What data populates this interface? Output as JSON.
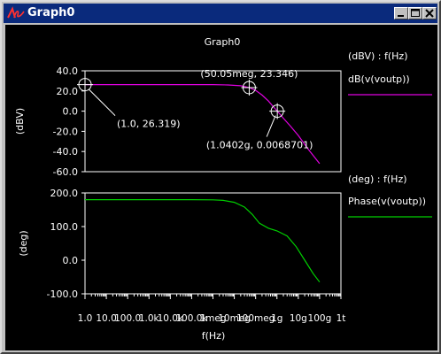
{
  "window": {
    "title": "Graph0"
  },
  "colors": {
    "titlebar": "#0a2a7c",
    "background": "#000000",
    "magnitude": "#e000e0",
    "phase": "#00d000",
    "frame": "#ffffff"
  },
  "icons": {
    "app": "app-logo-icon",
    "minimize": "minimize-icon",
    "maximize": "maximize-icon",
    "close": "close-icon"
  },
  "chart_data": [
    {
      "type": "line",
      "title": "Graph0",
      "xlabel": "f(Hz)",
      "ylabel": "(dBV)",
      "xscale": "log",
      "xlim": [
        1,
        1000000000000
      ],
      "ylim": [
        -60,
        40
      ],
      "yticks": [
        "40.0",
        "20.0",
        "0.0",
        "-20.0",
        "-40.0",
        "-60.0"
      ],
      "legend": {
        "placement": "right",
        "header": "(dBV) : f(Hz)",
        "label": "dB(v(voutp))"
      },
      "series": [
        {
          "name": "dB(v(voutp))",
          "x": [
            1,
            10,
            100,
            1000,
            10000,
            100000,
            1000000,
            5000000,
            20000000,
            50050000,
            100000000,
            200000000,
            400000000,
            700000000,
            1040200000,
            2000000000,
            4000000000,
            10000000000,
            30000000000,
            100000000000
          ],
          "y": [
            26.319,
            26.319,
            26.319,
            26.319,
            26.319,
            26.319,
            26.3,
            26.0,
            25.2,
            23.346,
            20.5,
            16,
            10,
            4,
            0.0068701,
            -7,
            -14,
            -24,
            -38,
            -52
          ]
        }
      ],
      "annotations": [
        {
          "label": "(1.0, 26.319)",
          "x": 1,
          "y": 26.319
        },
        {
          "label": "(50.05meg, 23.346)",
          "x": 50050000,
          "y": 23.346
        },
        {
          "label": "(1.0402g, 0.0068701)",
          "x": 1040200000,
          "y": 0.0068701
        }
      ]
    },
    {
      "type": "line",
      "xlabel": "f(Hz)",
      "ylabel": "(deg)",
      "xscale": "log",
      "xlim": [
        1,
        1000000000000
      ],
      "ylim": [
        -100,
        200
      ],
      "yticks": [
        "200.0",
        "100.0",
        "0.0",
        "-100.0"
      ],
      "xticks": [
        "1.0",
        "10.0",
        "100.0",
        "1.0k",
        "10.0k",
        "100.0k",
        "1meg",
        "10meg",
        "100meg",
        "1g",
        "10g",
        "100g",
        "1t"
      ],
      "legend": {
        "placement": "right",
        "header": "(deg) : f(Hz)",
        "label": "Phase(v(voutp))"
      },
      "series": [
        {
          "name": "Phase(v(voutp))",
          "x": [
            1,
            10,
            100,
            1000,
            10000,
            100000,
            1000000,
            3000000,
            10000000,
            30000000,
            70000000,
            150000000,
            400000000,
            1000000000,
            3000000000,
            8000000000,
            20000000000,
            50000000000,
            100000000000
          ],
          "y": [
            180,
            180,
            180,
            180,
            180,
            180,
            179.5,
            178,
            172,
            158,
            136,
            110,
            95,
            87,
            72,
            40,
            0,
            -40,
            -65
          ]
        }
      ]
    }
  ]
}
